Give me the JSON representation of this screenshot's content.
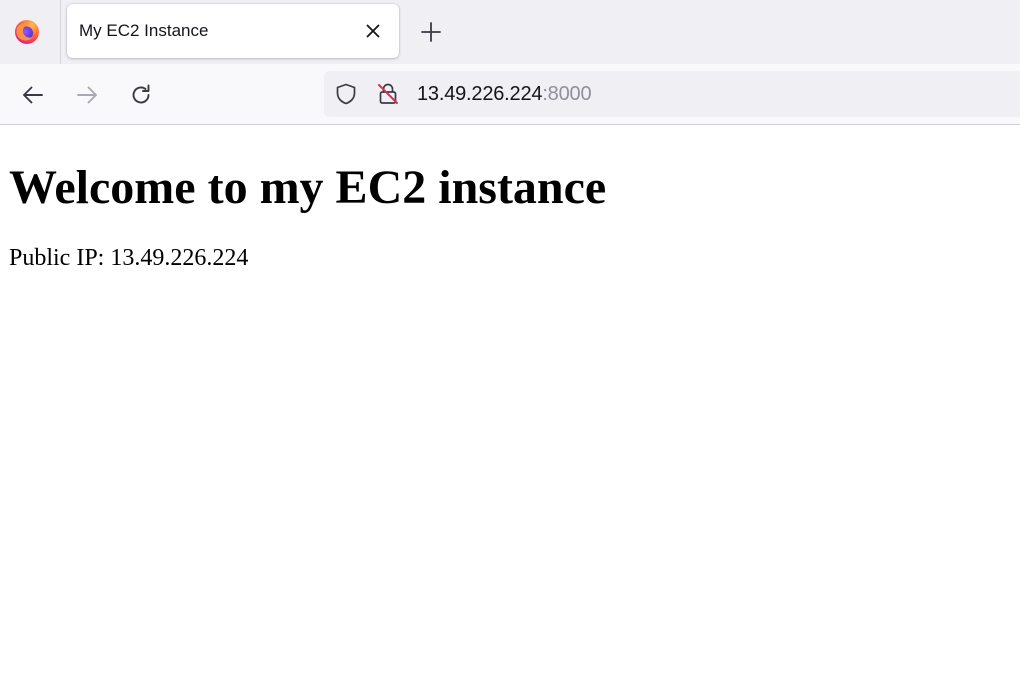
{
  "browser": {
    "logo_icon": "firefox-logo-icon",
    "tab": {
      "title": "My EC2 Instance",
      "close_icon": "close-icon"
    },
    "new_tab_icon": "plus-icon",
    "nav": {
      "back_icon": "arrow-left-icon",
      "forward_icon": "arrow-right-icon",
      "reload_icon": "reload-icon",
      "forward_enabled": false
    },
    "urlbar": {
      "shield_icon": "shield-icon",
      "lock_icon": "insecure-lock-icon",
      "host": "13.49.226.224",
      "port": ":8000"
    },
    "colors": {
      "tabstrip_bg": "#f0f0f4",
      "navbar_bg": "#f9f9fb",
      "insecure_red": "#e22850"
    }
  },
  "page": {
    "heading": "Welcome to my EC2 instance",
    "ip_text": "Public IP: 13.49.226.224"
  }
}
